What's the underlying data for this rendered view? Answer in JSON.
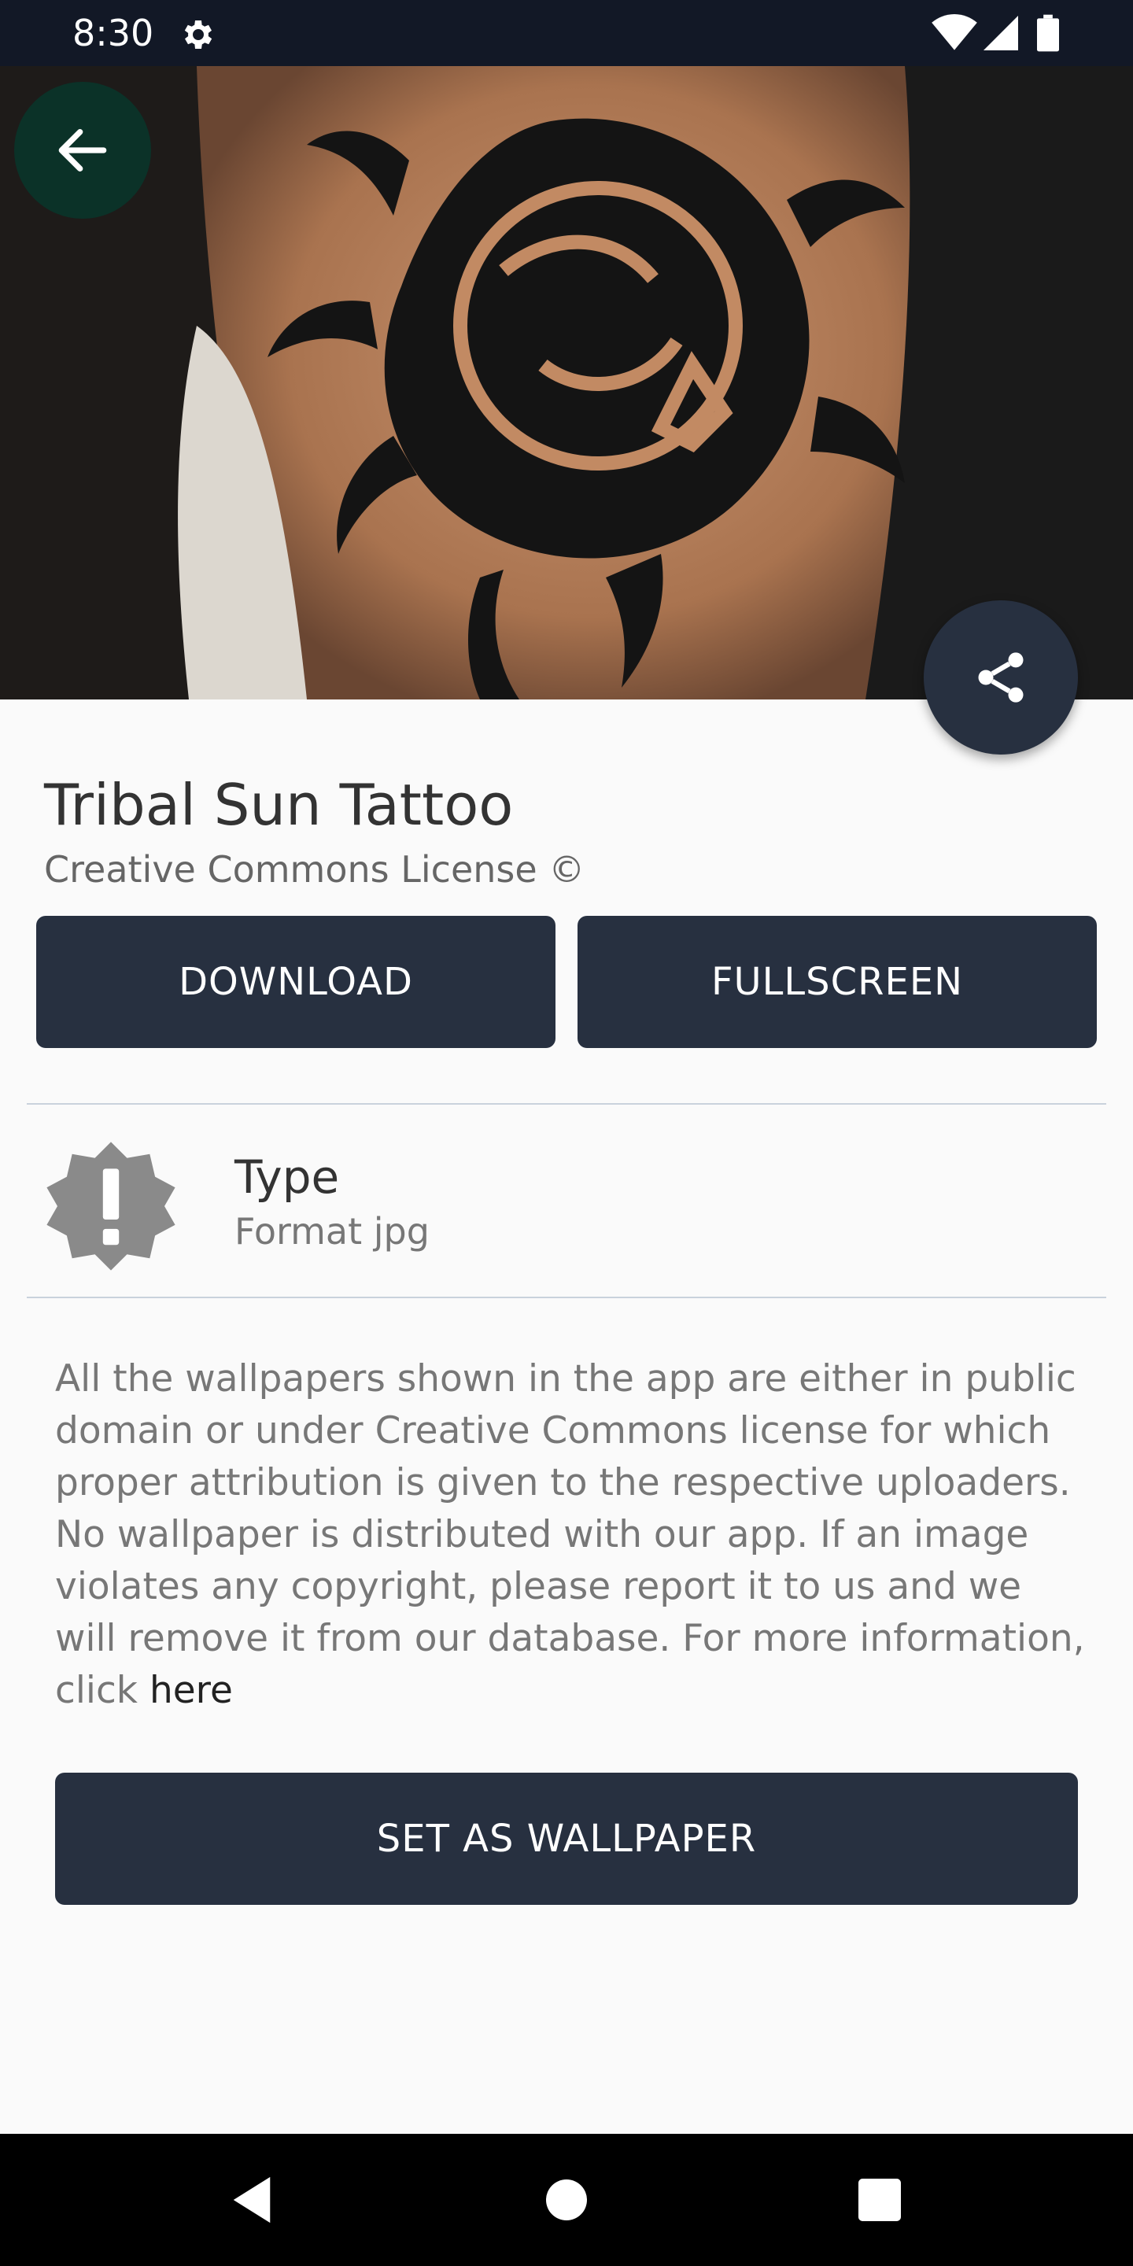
{
  "status_bar": {
    "time": "8:30",
    "icons": [
      "settings-gear-icon",
      "wifi-icon",
      "cellular-signal-icon",
      "battery-icon"
    ]
  },
  "hero": {
    "image_subject": "tribal sun tattoo on shoulder",
    "back_icon": "arrow-left-icon",
    "share_icon": "share-icon"
  },
  "wallpaper": {
    "title": "Tribal Sun Tattoo",
    "license": "Creative Commons License ©"
  },
  "actions": {
    "download_label": "DOWNLOAD",
    "fullscreen_label": "FULLSCREEN",
    "set_wallpaper_label": "SET AS WALLPAPER"
  },
  "info": {
    "icon": "alert-badge-icon",
    "title": "Type",
    "subtitle": "Format jpg"
  },
  "disclaimer": {
    "text": "All the wallpapers shown in the app are either in public domain or under Creative Commons license for which proper attribution is given to the respective uploaders. No wallpaper is distributed with our app. If an image violates any copyright, please report it to us and we will remove it from our database. For more information, click ",
    "link_label": "here"
  },
  "nav_bar": {
    "icons": [
      "nav-back-icon",
      "nav-home-icon",
      "nav-recents-icon"
    ]
  },
  "colors": {
    "primary": "#273040",
    "status_bar": "#121826",
    "background": "#fafafa",
    "back_button": "#08362c"
  }
}
